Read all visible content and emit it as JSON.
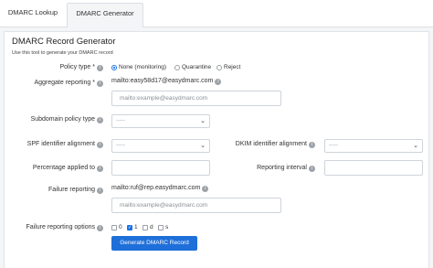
{
  "tabs": [
    {
      "label": "DMARC Lookup"
    },
    {
      "label": "DMARC Generator"
    }
  ],
  "panel": {
    "title": "DMARC Record Generator",
    "subtitle": "Use this tool to generate your DMARC record"
  },
  "form": {
    "policy_type": {
      "label": "Policy type *",
      "options": [
        "None (monitoring)",
        "Quarantine",
        "Reject"
      ],
      "selected": "None (monitoring)"
    },
    "aggregate_reporting": {
      "label": "Aggregate reporting *",
      "value": "mailto:easy58d17@easydmarc.com",
      "placeholder": "mailto:example@easydmarc.com"
    },
    "subdomain_policy": {
      "label": "Subdomain policy type",
      "value": "-----"
    },
    "spf_alignment": {
      "label": "SPF identifier alignment",
      "value": "-----"
    },
    "dkim_alignment": {
      "label": "DKIM identifier alignment",
      "value": "-----"
    },
    "percentage": {
      "label": "Percentage applied to",
      "value": ""
    },
    "reporting_interval": {
      "label": "Reporting interval",
      "value": ""
    },
    "failure_reporting": {
      "label": "Failure reporting",
      "value": "mailto:ruf@rep.easydmarc.com",
      "placeholder": "mailto:example@easydmarc.com"
    },
    "failure_options": {
      "label": "Failure reporting options",
      "options": [
        {
          "label": "0",
          "checked": false
        },
        {
          "label": "1",
          "checked": true
        },
        {
          "label": "d",
          "checked": false
        },
        {
          "label": "s",
          "checked": false
        }
      ]
    }
  },
  "generate_button": {
    "label": "Generate DMARC Record"
  },
  "colors": {
    "accent": "#1e6fd9"
  }
}
